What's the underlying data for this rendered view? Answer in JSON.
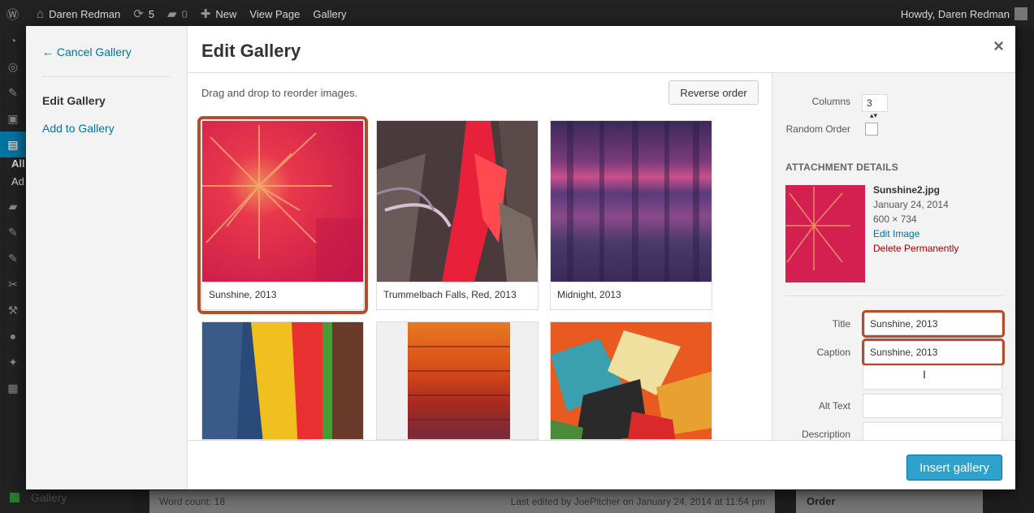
{
  "admin_bar": {
    "site_name": "Daren Redman",
    "updates_count": "5",
    "comments_count": "0",
    "new_label": "New",
    "view_page_label": "View Page",
    "gallery_label": "Gallery",
    "howdy": "Howdy, Daren Redman"
  },
  "admin_menu": {
    "all_label": "All",
    "add_label": "Ad",
    "gallery_label": "Gallery"
  },
  "editor_footer": {
    "word_count": "Word count: 18",
    "last_edited": "Last edited by JoePitcher on January 24, 2014 at 11:54 pm",
    "order_label": "Order"
  },
  "modal": {
    "title": "Edit Gallery",
    "close_glyph": "×",
    "menu": {
      "cancel": "← Cancel Gallery",
      "edit_gallery": "Edit Gallery",
      "add_to_gallery": "Add to Gallery"
    },
    "toolbar": {
      "hint": "Drag and drop to reorder images.",
      "reverse_order": "Reverse order"
    },
    "thumbnails": [
      {
        "caption": "Sunshine, 2013",
        "selected": true
      },
      {
        "caption": "Trummelbach Falls, Red, 2013",
        "selected": false
      },
      {
        "caption": "Midnight, 2013",
        "selected": false
      },
      {
        "caption": "",
        "selected": false
      },
      {
        "caption": "",
        "selected": false
      },
      {
        "caption": "",
        "selected": false
      }
    ],
    "settings": {
      "columns_label": "Columns",
      "columns_value": "3",
      "random_order_label": "Random Order"
    },
    "attachment": {
      "heading": "ATTACHMENT DETAILS",
      "filename": "Sunshine2.jpg",
      "date": "January 24, 2014",
      "dimensions": "600 × 734",
      "edit_image": "Edit Image",
      "delete": "Delete Permanently"
    },
    "fields": {
      "title_label": "Title",
      "title_value": "Sunshine, 2013",
      "caption_label": "Caption",
      "caption_value": "Sunshine, 2013",
      "alt_label": "Alt Text",
      "alt_value": "",
      "description_label": "Description",
      "description_value": ""
    },
    "insert_button": "Insert gallery"
  },
  "colors": {
    "highlight": "#b54d2b",
    "link": "#0074a2",
    "primary_button": "#2ea2cc"
  }
}
